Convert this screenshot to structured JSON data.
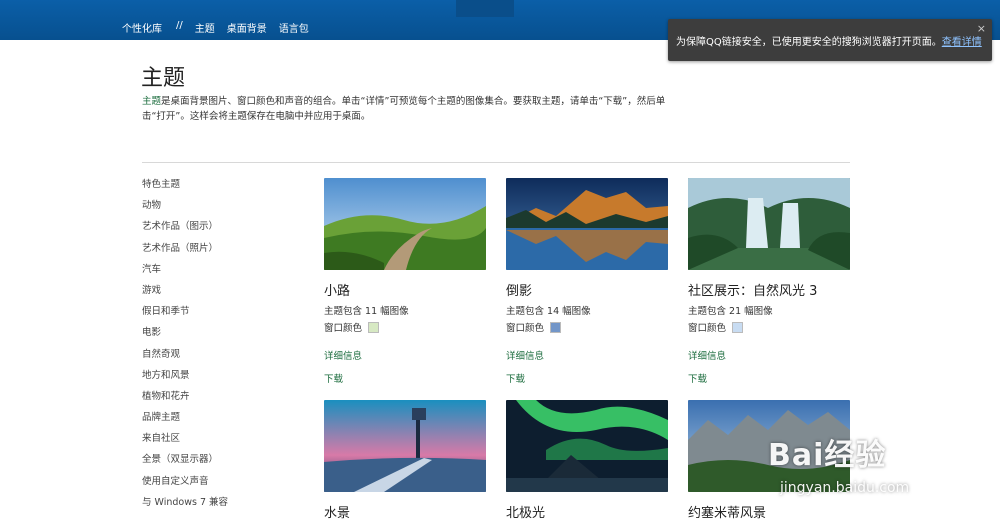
{
  "topbar": {
    "nav": [
      "个性化库",
      "//",
      "主题",
      "桌面背景",
      "语言包"
    ]
  },
  "banner": {
    "text": "为保障QQ链接安全，已使用更安全的搜狗浏览器打开页面。",
    "link": "查看详情",
    "close": "×"
  },
  "page": {
    "title": "主题",
    "intro_keyword": "主题",
    "intro_rest": "是桌面背景图片、窗口颜色和声音的组合。单击“详情”可预览每个主题的图像集合。要获取主题，请单击“下载”，然后单击“打开”。这样会将主题保存在电脑中并应用于桌面。"
  },
  "sidebar": {
    "items": [
      "特色主题",
      "动物",
      "艺术作品（图示）",
      "艺术作品（照片）",
      "汽车",
      "游戏",
      "假日和季节",
      "电影",
      "自然奇观",
      "地方和风景",
      "植物和花卉",
      "品牌主题",
      "来自社区",
      "全景（双显示器）",
      "使用自定义声音",
      "与 Windows 7 兼容"
    ]
  },
  "cards": [
    {
      "name": "小路",
      "meta": "主题包含 11 幅图像",
      "color_label": "窗口颜色",
      "swatch": "#d7e9c3",
      "details": "详细信息",
      "download": "下载"
    },
    {
      "name": "倒影",
      "meta": "主题包含 14 幅图像",
      "color_label": "窗口颜色",
      "swatch": "#7396c8",
      "details": "详细信息",
      "download": "下载"
    },
    {
      "name": "社区展示：自然风光 3",
      "meta": "主题包含 21 幅图像",
      "color_label": "窗口颜色",
      "swatch": "#c8dcf2",
      "details": "详细信息",
      "download": "下载"
    },
    {
      "name": "水景"
    },
    {
      "name": "北极光"
    },
    {
      "name": "约塞米蒂风景"
    }
  ],
  "watermark": {
    "brand": "Bai经验",
    "url": "jingyan.baidu.com"
  }
}
